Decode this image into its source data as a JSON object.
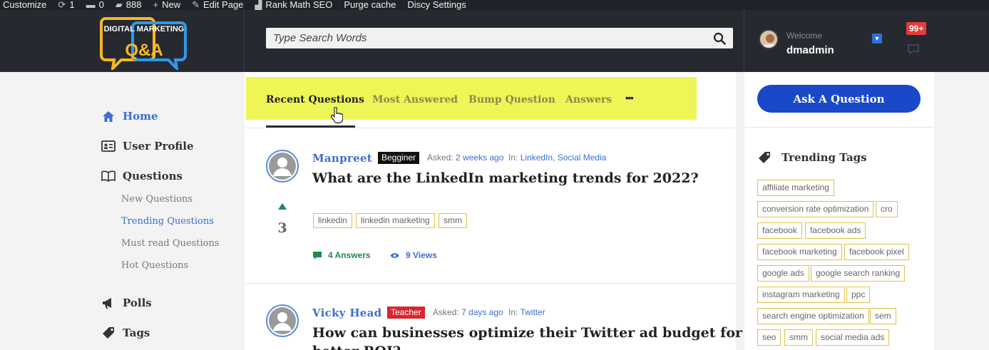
{
  "adminbar": {
    "customize": "Customize",
    "updates": "1",
    "comments": "0",
    "pending": "888",
    "new": "New",
    "edit_page": "Edit Page",
    "rank_math": "Rank Math SEO",
    "purge_cache": "Purge cache",
    "discy_settings": "Discy Settings"
  },
  "header": {
    "logo_line1": "DIGITAL MARKETING",
    "logo_line2": "Q&A",
    "search_placeholder": "Type Search Words",
    "welcome": "Welcome",
    "username": "dmadmin",
    "notifications": "99+"
  },
  "nav": {
    "home": "Home",
    "user_profile": "User Profile",
    "questions": "Questions",
    "sub": [
      "New Questions",
      "Trending Questions",
      "Must read Questions",
      "Hot Questions"
    ],
    "polls": "Polls",
    "tags": "Tags"
  },
  "tabs": [
    "Recent Questions",
    "Most Answered",
    "Bump Question",
    "Answers"
  ],
  "tabs_more": "•••",
  "questions": [
    {
      "author": "Manpreet",
      "badge": "Begginer",
      "asked_label": "Asked:",
      "asked": "2 weeks ago",
      "in_label": "In:",
      "categories": "LinkedIn, Social Media",
      "title": "What are the LinkedIn marketing trends for 2022?",
      "votes": "3",
      "tags": [
        "linkedin",
        "linkedin marketing",
        "smm"
      ],
      "answers": "4 Answers",
      "views": "9 Views"
    },
    {
      "author": "Vicky Head",
      "badge": "Teacher",
      "asked_label": "Asked:",
      "asked": "7 days ago",
      "in_label": "In:",
      "categories": "Twitter",
      "title": "How can businesses optimize their Twitter ad budget for",
      "title_cont": "better ROI?"
    }
  ],
  "right": {
    "ask_button": "Ask A Question",
    "trending_title": "Trending Tags",
    "tags": [
      "affiliate marketing",
      "conversion rate optimization",
      "cro",
      "facebook",
      "facebook ads",
      "facebook marketing",
      "facebook pixel",
      "google ads",
      "google search ranking",
      "instagram marketing",
      "ppc",
      "search engine optimization",
      "sem",
      "seo",
      "smm",
      "social media ads"
    ]
  },
  "colors": {
    "accent_blue": "#3b6fd4",
    "ask_button": "#1949c9",
    "highlight": "#eef556",
    "tag_border": "#e2c14a",
    "header_bg": "#272930",
    "badge_red": "#d7272d"
  }
}
